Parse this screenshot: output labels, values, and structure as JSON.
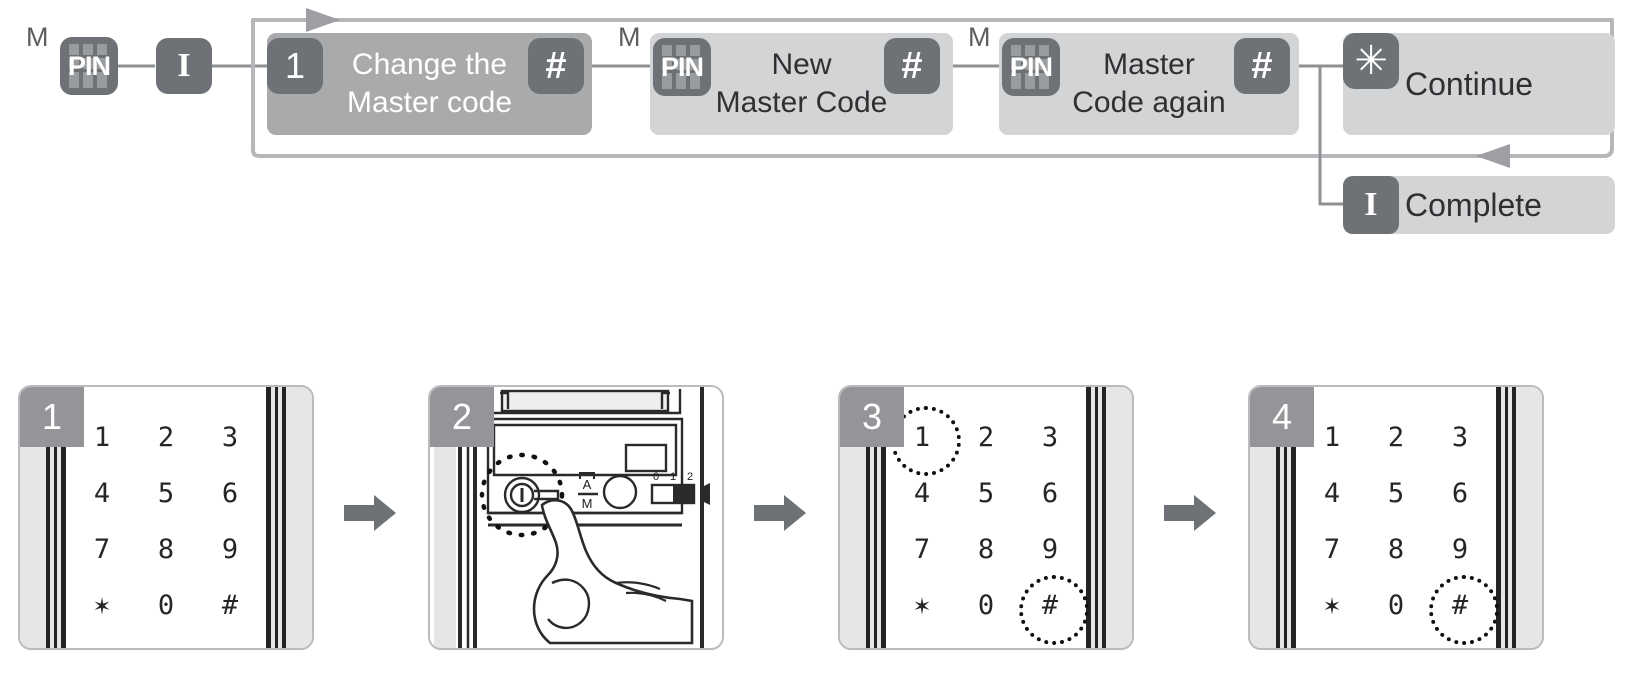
{
  "flow": {
    "entry": {
      "m_label": "M",
      "pin_icon": "pin-keypad-icon",
      "pin_text": "PIN",
      "i_icon": "i-button-icon",
      "i_text": "I"
    },
    "steps": [
      {
        "number": "1",
        "title_line1": "Change the",
        "title_line2": "Master code",
        "confirm_icon": "hash-key-icon",
        "confirm_text": "#",
        "style": "dark"
      },
      {
        "m_label": "M",
        "pin_icon": "pin-keypad-icon",
        "pin_text": "PIN",
        "title_line1": "New",
        "title_line2": "Master Code",
        "confirm_icon": "hash-key-icon",
        "confirm_text": "#",
        "style": "light"
      },
      {
        "m_label": "M",
        "pin_icon": "pin-keypad-icon",
        "pin_text": "PIN",
        "title_line1": "Master",
        "title_line2": "Code again",
        "confirm_icon": "hash-key-icon",
        "confirm_text": "#",
        "style": "light"
      }
    ],
    "continue_node": {
      "icon": "asterisk-key-icon",
      "icon_text": "✳",
      "label": "Continue"
    },
    "complete_node": {
      "icon": "i-button-icon",
      "icon_text": "I",
      "label": "Complete"
    }
  },
  "panels": [
    {
      "badge": "1",
      "type": "keypad",
      "keys": [
        "1",
        "2",
        "3",
        "4",
        "5",
        "6",
        "7",
        "8",
        "9",
        "✶",
        "0",
        "#"
      ],
      "highlighted": []
    },
    {
      "badge": "2",
      "type": "illustration",
      "controls": {
        "power_button": "I",
        "mode_switch_top": "A",
        "mode_switch_bottom": "M",
        "volume_ticks": [
          "0",
          "1",
          "2"
        ],
        "speaker_icon": "speaker-icon",
        "hand_icon": "pressing-finger-icon"
      }
    },
    {
      "badge": "3",
      "type": "keypad",
      "keys": [
        "1",
        "2",
        "3",
        "4",
        "5",
        "6",
        "7",
        "8",
        "9",
        "✶",
        "0",
        "#"
      ],
      "highlighted": [
        0,
        11
      ]
    },
    {
      "badge": "4",
      "type": "keypad",
      "keys": [
        "1",
        "2",
        "3",
        "4",
        "5",
        "6",
        "7",
        "8",
        "9",
        "✶",
        "0",
        "#"
      ],
      "highlighted": [
        11
      ]
    }
  ],
  "step_arrows": [
    "step-arrow-1",
    "step-arrow-2",
    "step-arrow-3"
  ],
  "colors": {
    "chip_dark": "#6e7175",
    "slab_dark": "#a8aaac",
    "slab_light": "#d2d4d6",
    "badge": "#939598",
    "line": "#9a9ca0",
    "keypad_band": "#e4e6e8",
    "arrow": "#6e7175"
  }
}
